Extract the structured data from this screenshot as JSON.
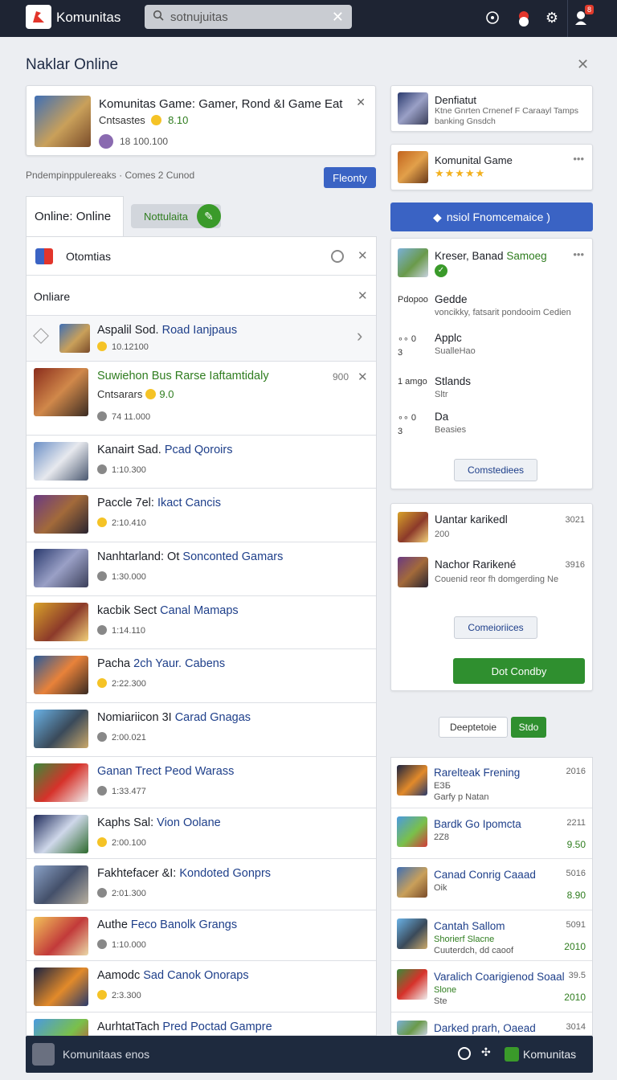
{
  "topbar": {
    "brand": "Komunitas",
    "search_value": "sotnujuitas",
    "notif_badge": "8"
  },
  "page": {
    "title": "Naklar Online"
  },
  "featured": {
    "title": "Komunitas Game: Gamer, Rond &I Game Eat",
    "subtitle": "Cntsastes",
    "rating": "8.10",
    "meta": "18 100.100"
  },
  "filterbar": {
    "text": "Pndempinppulereaks",
    "sep": "·",
    "count": "Comes 2 Cunod",
    "button": "Fleonty"
  },
  "tabs": [
    {
      "label": "Online: Online"
    },
    {
      "label": "Nottulaita"
    }
  ],
  "filters": {
    "row1_label": "Otomtias",
    "row2_label": "Onliare"
  },
  "list": [
    {
      "a": "Aspalil Sod. ",
      "b": "Road Ianjpaus",
      "meta": "10.12100",
      "cls": "t1"
    },
    {
      "a": "Suwiehon Bus Rarse Iaftamtidaly",
      "b": "",
      "sub": "Cntsarars",
      "rating": "9.0",
      "meta": "74 11.000",
      "num": "900",
      "cls": "t2"
    },
    {
      "a": "Kanairt Sad. ",
      "b": "Pcad Qoroirs",
      "meta": "1:10.300",
      "cls": "t3"
    },
    {
      "a": "Paccle 7el: ",
      "b": "Ikact Cancis",
      "meta": "2:10.410",
      "cls": "t4"
    },
    {
      "a": "Nanhtarland: Ot ",
      "b": "Sonconted Gamars",
      "meta": "1:30.000",
      "cls": "t5"
    },
    {
      "a": "kacbik Sect ",
      "b": "Canal Mamaps",
      "meta": "1:14.110",
      "cls": "t6"
    },
    {
      "a": "Pacha ",
      "b": "2ch Yaur. Cabens",
      "meta": "2:22.300",
      "cls": "t7"
    },
    {
      "a": "Nomiariicon 3I ",
      "b": "Carad Gnagas",
      "meta": "2:00.021",
      "cls": "t8"
    },
    {
      "a": "",
      "b": "Ganan Trect Peod Warass",
      "meta": "1:33.477",
      "cls": "t9"
    },
    {
      "a": "Kaphs Sal: ",
      "b": "Vion Oolane",
      "meta": "2:00.100",
      "cls": "t10"
    },
    {
      "a": "Fakhtefacer &I: ",
      "b": "Kondoted Gonprs",
      "meta": "2:01.300",
      "cls": "t11"
    },
    {
      "a": "Authe ",
      "b": "Feco Banolk Grangs",
      "meta": "1:10.000",
      "cls": "t12"
    },
    {
      "a": "Aamodc ",
      "b": "Sad Canok Onoraps",
      "meta": "2:3.300",
      "cls": "t13"
    },
    {
      "a": "AurhtatTach ",
      "b": "Pred Poctad Gampre",
      "meta": "",
      "cls": "t14"
    }
  ],
  "right": {
    "card1": {
      "title": "Denfiatut",
      "line1": "Ktne Gnrten Crnenef F Caraayl Tamps",
      "line2": "banking Gnsdch"
    },
    "card2": {
      "title": "Komunital Game",
      "rating": 4.5
    },
    "action_button": "nsiol Fnomcemaice )",
    "card3": {
      "title_a": "Kreser, Banad ",
      "title_b": "Samoeg",
      "rows": [
        {
          "k": "Pdopoo",
          "t": "Gedde",
          "s": "voncikky, fatsarit pondooim Cedien"
        },
        {
          "k": "∘∘ 0",
          "k2": "3",
          "t": "Applc",
          "s": "SualleHao"
        },
        {
          "k": "1 amgo",
          "t": "Stlands",
          "s": "Sltr"
        },
        {
          "k": "∘∘ 0",
          "k2": "3",
          "t": "Da",
          "s": "Beasies"
        }
      ],
      "button": "Comstediees"
    },
    "card4": {
      "items": [
        {
          "title": "Uantar karikedl",
          "sub": "200",
          "num": "3021"
        },
        {
          "title": "Nachor Rarikené",
          "sub": "Couenid reor fh domgerding Ne",
          "num": "3916"
        }
      ],
      "button1": "Comeioriices",
      "button2": "Dot Condby"
    },
    "pager": {
      "btn1": "Deeptetoie",
      "btn2": "Stdo"
    },
    "list": [
      {
        "title": "Rarelteak Frening",
        "sub1": "ЕЗБ",
        "sub2": "Garfy p Natan",
        "num": "2016",
        "price": "",
        "cls": "t13"
      },
      {
        "title": "Bardk Go Ipomcta",
        "sub1": "2Z8",
        "sub2": "",
        "num": "2211",
        "price": "9.50",
        "cls": "t14"
      },
      {
        "title": "Canad Conrig Caaad",
        "sub1": "Oik",
        "sub2": "",
        "num": "5016",
        "price": "8.90",
        "cls": "t1"
      },
      {
        "title": "Cantah Sallom",
        "sub1": "Shorierf Slacne",
        "sub2": "Cuuterdch, dd caoof",
        "num": "5091",
        "price": "2010",
        "cls": "t8"
      },
      {
        "title": "Varalich Coarigienod Soaal",
        "sub1": "Slone",
        "sub2": "Ste",
        "num": "39.5",
        "price": "2010",
        "cls": "t9"
      },
      {
        "title": "Darked prarh, Oaead",
        "sub1": "",
        "sub2": "",
        "num": "3014",
        "price": "",
        "cls": "t16"
      }
    ]
  },
  "bottombar": {
    "label": "Komunitaas enos",
    "right_label": "Komunitas"
  },
  "colors": {
    "accent_blue": "#3a63c4",
    "accent_green": "#2f8f2f",
    "topbar": "#1e2433"
  }
}
